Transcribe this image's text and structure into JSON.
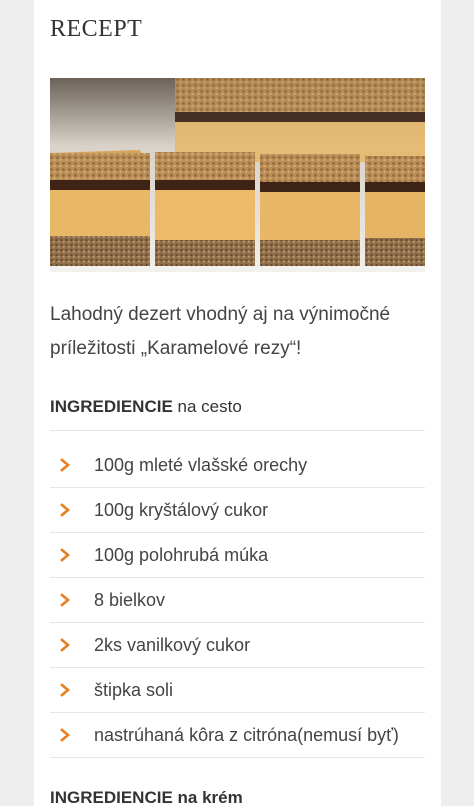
{
  "page": {
    "title": "RECEPT",
    "intro": "Lahodný dezert vhodný aj na výnimočné príležitosti „Karamelové rezy“!"
  },
  "sections": [
    {
      "bold": "INGREDIENCIE",
      "rest": " na cesto"
    },
    {
      "bold": "INGREDIENCIE na krém",
      "rest": ""
    }
  ],
  "ingredients": [
    "100g mleté vlašské orechy",
    "100g kryštálový cukor",
    "100g polohrubá múka",
    "8 bielkov",
    "2ks vanilkový cukor",
    "štipka soli",
    "nastrúhaná kôra z citróna(nemusí byť)"
  ],
  "colors": {
    "accent": "#e67e22",
    "text": "#444444"
  },
  "icons": {
    "bullet": "chevron-right-icon"
  }
}
